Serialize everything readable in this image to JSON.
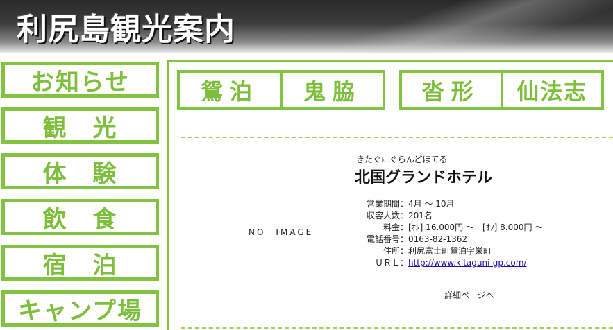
{
  "header": {
    "title": "利尻島観光案内"
  },
  "sidebar": {
    "items": [
      {
        "label": "お知らせ"
      },
      {
        "label": "観　光"
      },
      {
        "label": "体　験"
      },
      {
        "label": "飲　食"
      },
      {
        "label": "宿　泊"
      },
      {
        "label": "キャンプ場"
      }
    ]
  },
  "area_tabs": {
    "group1": [
      "鴛泊",
      "鬼脇"
    ],
    "group2": [
      "沓形",
      "仙法志"
    ]
  },
  "listing": {
    "image_placeholder": "NO　IMAGE",
    "furigana": "きたぐにぐらんどほてる",
    "name": "北国グランドホテル",
    "fields": [
      {
        "label": "営業期間：",
        "value": "4月 ～ 10月"
      },
      {
        "label": "収容人数：",
        "value": "201名"
      },
      {
        "label": "料金：",
        "value": "[ｵﾝ] 16.000円 ～　[ｵﾌ] 8.000円 ～"
      },
      {
        "label": "電話番号：",
        "value": "0163-82-1362"
      },
      {
        "label": "住所：",
        "value": "利尻富士町鴛泊字栄町"
      }
    ],
    "url_label": "ＵＲＬ：",
    "url": "http://www.kitaguni-gp.com/",
    "detail_link": "詳細ページへ"
  },
  "colors": {
    "accent_green": "#82c341",
    "header_dark": "#2a2a2a"
  }
}
